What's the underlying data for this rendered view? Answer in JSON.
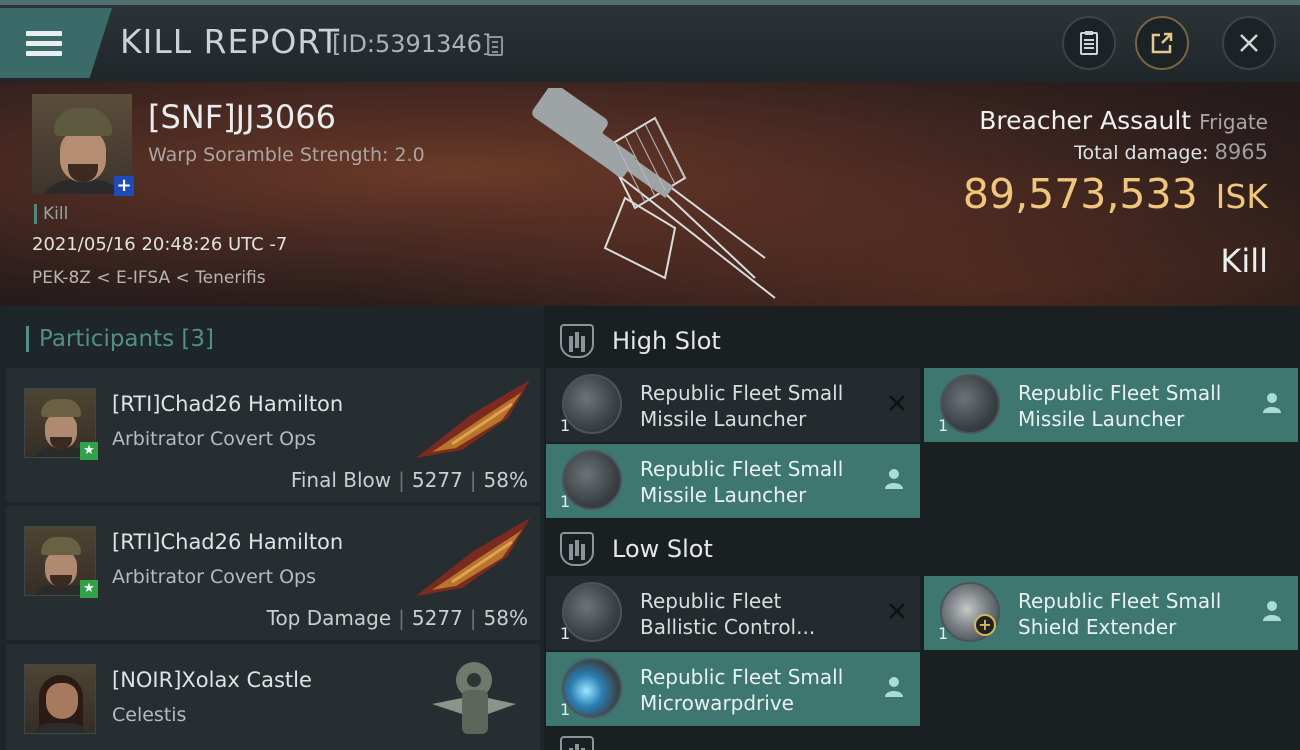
{
  "header": {
    "title": "KILL REPORT",
    "id_label": "[ID:5391346]"
  },
  "victim": {
    "name": "[SNF]JJ3066",
    "scramble": "Warp Soramble Strength: 2.0",
    "kill_tag": "Kill",
    "datetime": "2021/05/16 20:48:26 UTC -7",
    "location": "PEK-8Z < E-IFSA < Tenerifis",
    "ship_name": "Breacher Assault",
    "ship_class": "Frigate",
    "total_damage_label": "Total damage:",
    "total_damage": "8965",
    "isk_value": "89,573,533",
    "isk_unit": "ISK",
    "result": "Kill"
  },
  "participants": {
    "heading": "Participants [3]",
    "rows": [
      {
        "name": "[RTI]Chad26 Hamilton",
        "ship": "Arbitrator Covert Ops",
        "role": "Final Blow",
        "damage": "5277",
        "percent": "58%"
      },
      {
        "name": "[RTI]Chad26 Hamilton",
        "ship": "Arbitrator Covert Ops",
        "role": "Top Damage",
        "damage": "5277",
        "percent": "58%"
      },
      {
        "name": "[NOIR]Xolax Castle",
        "ship": "Celestis"
      }
    ]
  },
  "fitting": {
    "high_slot_label": "High Slot",
    "low_slot_label": "Low Slot",
    "high": [
      {
        "line1": "Republic Fleet Small",
        "line2": "Missile Launcher",
        "qty": "1",
        "state": "destroyed"
      },
      {
        "line1": "Republic Fleet Small",
        "line2": "Missile Launcher",
        "qty": "1",
        "state": "dropped"
      },
      {
        "line1": "Republic Fleet Small",
        "line2": "Missile Launcher",
        "qty": "1",
        "state": "dropped"
      }
    ],
    "low": [
      {
        "line1": "Republic Fleet",
        "line2": "Ballistic Control...",
        "qty": "1",
        "state": "destroyed"
      },
      {
        "line1": "Republic Fleet Small",
        "line2": "Shield Extender",
        "qty": "1",
        "state": "dropped"
      },
      {
        "line1": "Republic Fleet Small",
        "line2": "Microwarpdrive",
        "qty": "1",
        "state": "dropped"
      }
    ]
  },
  "colors": {
    "accent_teal": "#3d7770",
    "isk_gold": "#f0c77a",
    "header_bg": "#2c3438"
  }
}
